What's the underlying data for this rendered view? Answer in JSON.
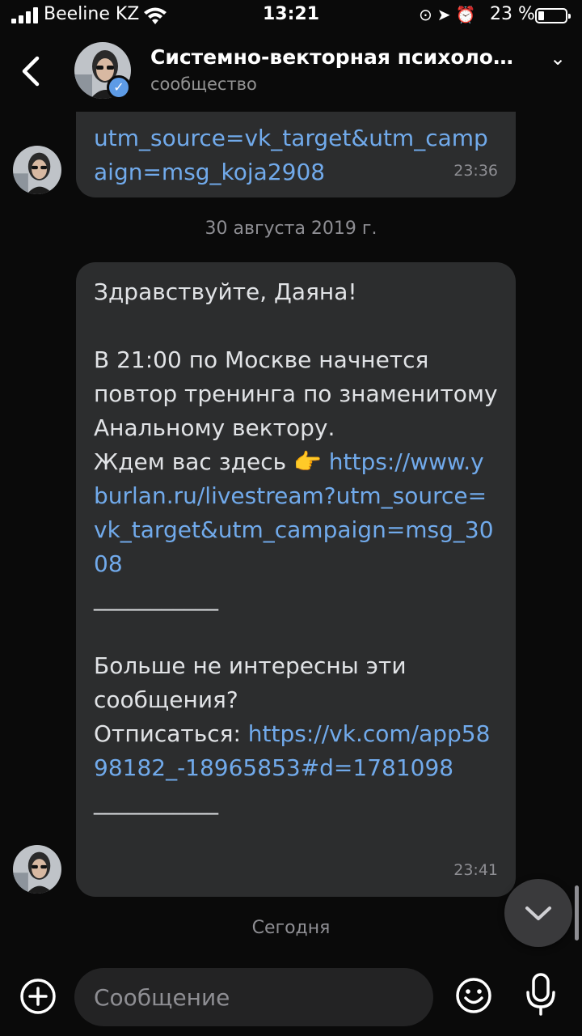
{
  "status_bar": {
    "carrier": "Beeline KZ",
    "time": "13:21",
    "battery": "23 %",
    "battery_level": 0.23
  },
  "header": {
    "title": "Системно-векторная психоло…",
    "subtitle": "сообщество",
    "verified_icon": "check-icon"
  },
  "messages": [
    {
      "text_prefix": "",
      "link": "utm_source=vk_target&utm_campaign=msg_koja2908",
      "time": "23:36"
    },
    {
      "greeting": "Здравствуйте, Даяна!",
      "body": "В 21:00 по Москве начнется повтор тренинга по знаменитому Анальному вектору.",
      "invite": "Ждем вас здесь 👉",
      "link1": "https://www.yburlan.ru/livestream?utm_source=vk_target&utm_campaign=msg_3008",
      "divider1": "___________",
      "unsubscribe_question": "Больше не интересны эти сообщения?",
      "unsubscribe_label": "Отписаться:",
      "link2": "https://vk.com/app5898182_-18965853#d=1781098",
      "divider2": "___________",
      "time": "23:41"
    }
  ],
  "date_separators": [
    "30 августа 2019 г.",
    "Сегодня"
  ],
  "composer": {
    "placeholder": "Сообщение"
  },
  "colors": {
    "background": "#0a0a0a",
    "bubble": "#2c2d2e",
    "link": "#71aaeb",
    "accent": "#5d9be6"
  }
}
